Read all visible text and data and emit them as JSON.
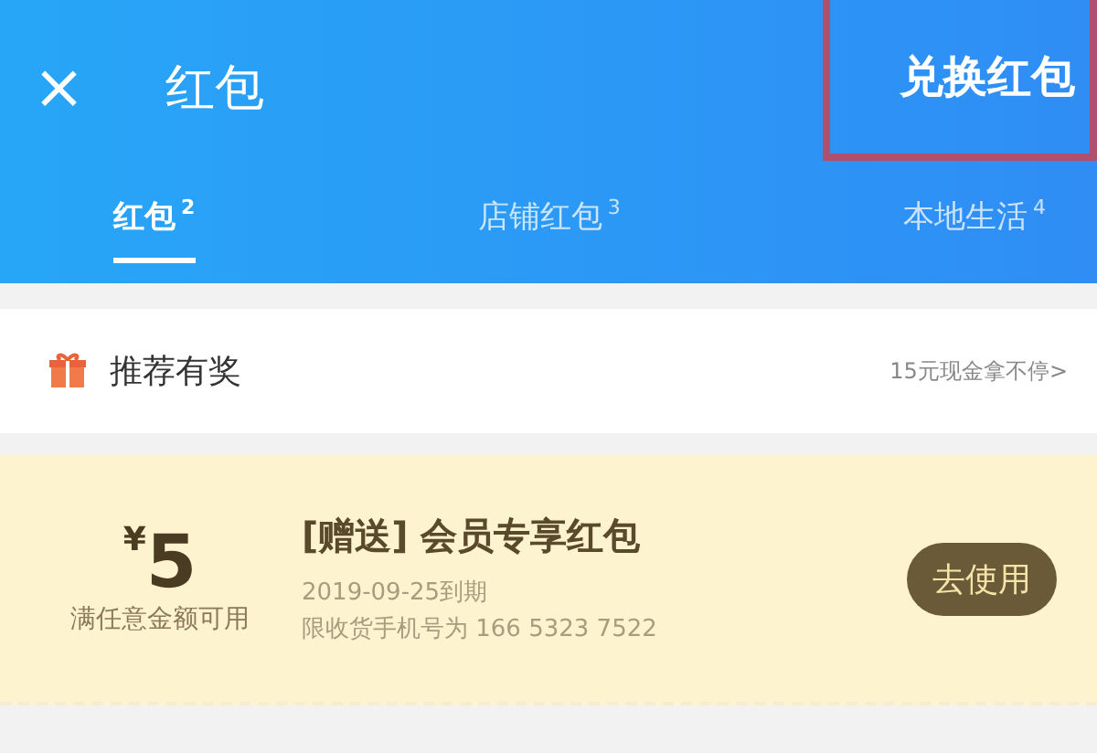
{
  "header": {
    "close": "×",
    "title": "红包",
    "action": {
      "label": "兑换红包",
      "highlighted": true
    }
  },
  "tabs": [
    {
      "label": "红包",
      "count": "2",
      "selected": true
    },
    {
      "label": "店铺红包",
      "count": "3",
      "selected": false
    },
    {
      "label": "本地生活",
      "count": "4",
      "selected": false
    }
  ],
  "promo": {
    "label": "推荐有奖",
    "link": "15元现金拿不停>"
  },
  "coupons": [
    {
      "currency": "¥",
      "amount": "5",
      "condition": "满任意金额可用",
      "tag": "[赠送]",
      "title": "会员专享红包",
      "expiry": "2019-09-25到期",
      "restriction": "限收货手机号为 166 5323 7522",
      "button": "去使用"
    }
  ]
}
